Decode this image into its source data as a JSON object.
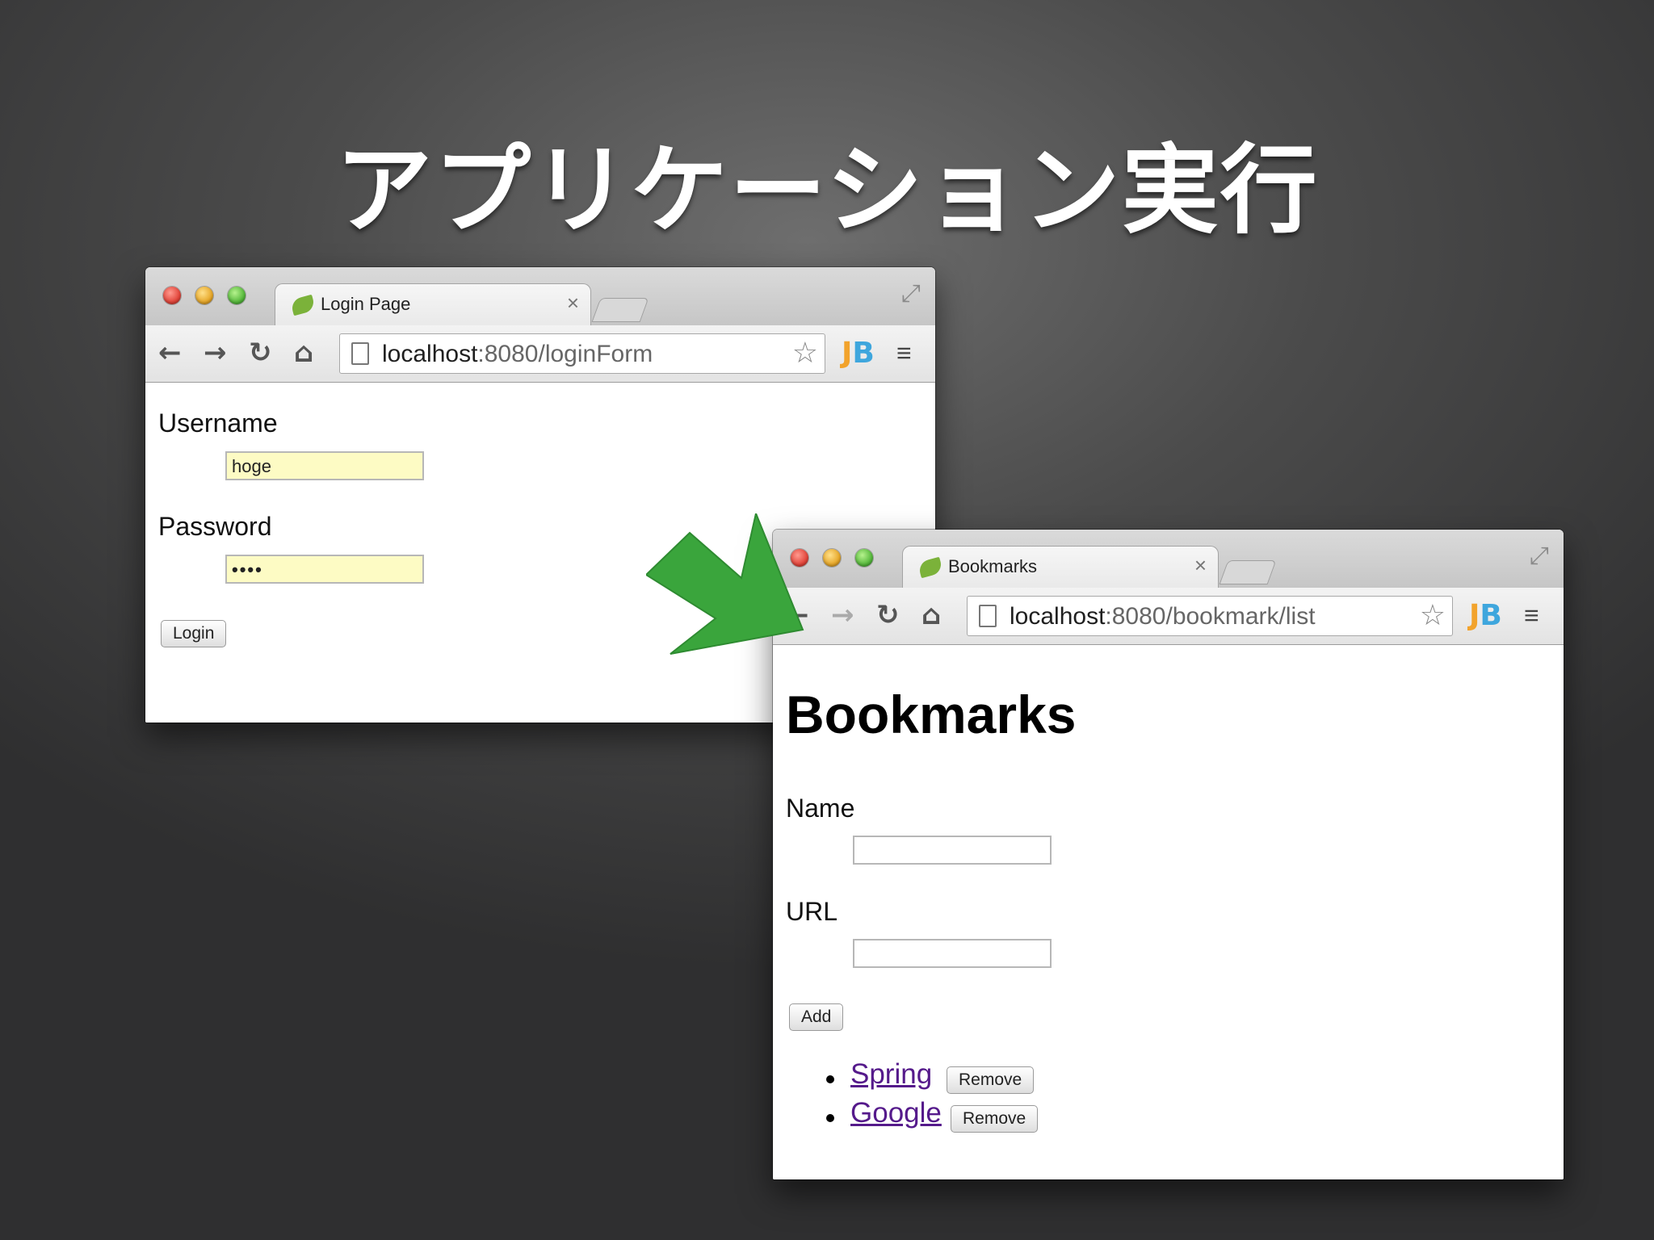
{
  "slide": {
    "title": "アプリケーション実行"
  },
  "login_window": {
    "tab_title": "Login Page",
    "tab_close": "×",
    "url_host": "localhost",
    "url_rest": ":8080/loginForm",
    "username_label": "Username",
    "username_value": "hoge",
    "password_label": "Password",
    "password_value": "••••",
    "login_button": "Login"
  },
  "bookmarks_window": {
    "tab_title": "Bookmarks",
    "tab_close": "×",
    "url_host": "localhost",
    "url_rest": ":8080/bookmark/list",
    "heading": "Bookmarks",
    "name_label": "Name",
    "name_value": "",
    "url_label": "URL",
    "url_value": "",
    "add_button": "Add",
    "bookmarks": [
      {
        "name": "Spring",
        "remove": "Remove"
      },
      {
        "name": "Google",
        "remove": "Remove"
      }
    ]
  },
  "icons": {
    "back": "←",
    "forward": "→",
    "reload": "↻",
    "home": "⌂",
    "star": "☆",
    "menu": "≡",
    "resize": "⤢",
    "jb_j": "J",
    "jb_b": "B"
  },
  "colors": {
    "arrow": "#3aa53c",
    "autofill": "#fdfbc4",
    "visited_link": "#551a8b"
  }
}
